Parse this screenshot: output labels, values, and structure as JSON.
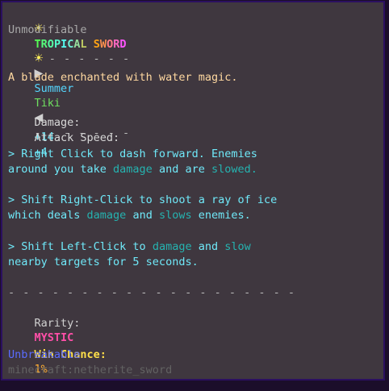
{
  "title": {
    "left_icon": "sun-icon",
    "right_icon": "sun-icon",
    "text": "TROPICAL SWORD",
    "gradient": [
      "#55ff55",
      "#55ffff",
      "#ffaa00",
      "#ff55ff"
    ]
  },
  "unmodifiable": "Unmodifiable",
  "set_header": {
    "dashes_left": "- - - - - - -",
    "dashes_right": "- - - - - - -",
    "left_icon": "triangle-right-icon",
    "right_icon": "triangle-left-icon",
    "word1": "Summer",
    "word2": "Tiki"
  },
  "description": "A blade enchanted with water magic.",
  "stats": [
    {
      "label": "Damage:",
      "value": "+14"
    },
    {
      "label": "Attack Speed:",
      "value": "+4"
    }
  ],
  "abilities": {
    "a1_l1_pre": "> Right Click to dash forward. Enemies",
    "a1_l2_pre": "around you take ",
    "a1_l2_k1": "damage",
    "a1_l2_mid": " and are ",
    "a1_l2_k2": "slowed.",
    "a2_l1_pre": "> Shift Right-Click to shoot a ray of ice",
    "a2_l2_pre": "which deals ",
    "a2_l2_k1": "damage",
    "a2_l2_mid": " and ",
    "a2_l2_k2": "slows",
    "a2_l2_post": " enemies.",
    "a3_l1_pre": "> Shift Left-Click to ",
    "a3_l1_k1": "damage",
    "a3_l1_mid": " and ",
    "a3_l1_k2": "slow",
    "a3_l2": "nearby targets for 5 seconds."
  },
  "divider": "- - - - - - - - - - - - - - - - - - - -",
  "rarity": {
    "label": "Rarity:",
    "value": "MYSTIC"
  },
  "win_chance": {
    "label": "Win Chance:",
    "value": "1%"
  },
  "unbreakable": "Unbreakable",
  "item_id": "minecraft:netherite_sword"
}
